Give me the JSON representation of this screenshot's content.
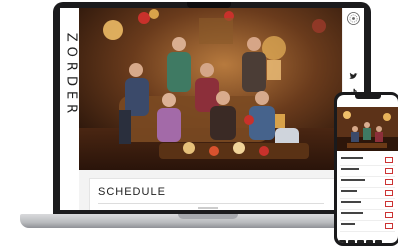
{
  "site": {
    "brand": "ZORDER",
    "section_title": "SCHEDULE"
  },
  "icons": {
    "seal": "seal-emblem-icon",
    "social": [
      "twitter-icon",
      "tiktok-icon"
    ],
    "phone_bottom": [
      "share-icon",
      "menu-icon",
      "home-icon",
      "grid-icon",
      "profile-icon"
    ]
  },
  "colors": {
    "laptop_frame": "#1b1b1d",
    "hero_warm": "#6a3b1c",
    "accent_red": "#c8312b"
  }
}
